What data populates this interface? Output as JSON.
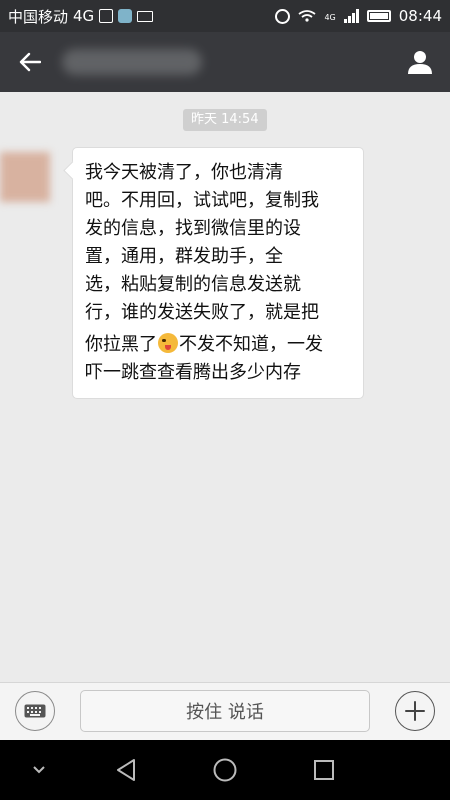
{
  "status_bar": {
    "carrier": "中国移动",
    "network": "4G",
    "network_small": "4G",
    "time": "08:44"
  },
  "nav": {
    "back_icon": "back-arrow-icon",
    "profile_icon": "person-icon"
  },
  "chat": {
    "timestamp": "昨天 14:54",
    "message": {
      "lines": [
        "我今天被清了，你也清清",
        "吧。不用回，试试吧，复制我",
        "发的信息，找到微信里的设",
        "置，通用，群发助手，全",
        "选，粘贴复制的信息发送就",
        "行，谁的发送失败了，就是把",
        "你拉黑了",
        "不发不知道，一发",
        "吓一跳查查看腾出多少内存"
      ],
      "emoji": "tongue-out-emoji"
    }
  },
  "input_bar": {
    "voice_label": "按住 说话",
    "keyboard_icon": "keyboard-icon",
    "plus_icon": "plus-icon"
  },
  "colors": {
    "status_bg": "#2f3033",
    "nav_bg": "#38393d",
    "chat_bg": "#ebebeb",
    "bubble_bg": "#ffffff",
    "sys_nav_bg": "#000000"
  }
}
